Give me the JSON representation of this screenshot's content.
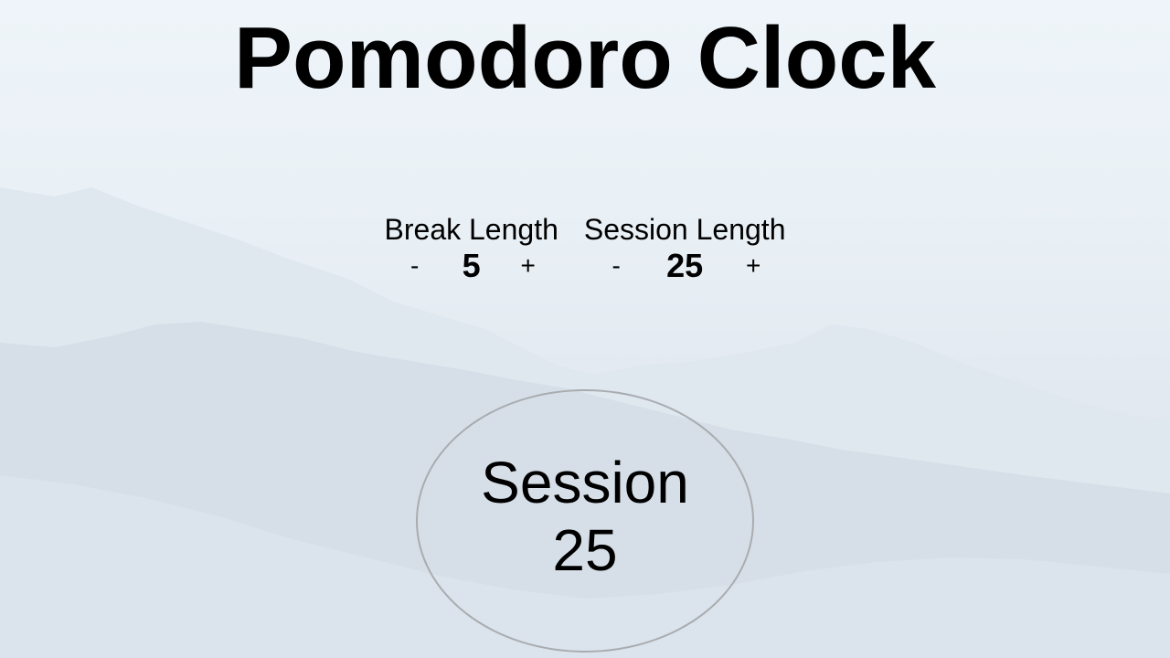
{
  "app": {
    "title": "Pomodoro Clock"
  },
  "break": {
    "label": "Break Length",
    "decrement_label": "-",
    "value": "5",
    "increment_label": "+"
  },
  "session": {
    "label": "Session Length",
    "decrement_label": "-",
    "value": "25",
    "increment_label": "+"
  },
  "timer": {
    "mode_label": "Session",
    "time": "25"
  },
  "colors": {
    "sky": "#eef4f9",
    "mountain_far": "#dfe6ee",
    "mountain_near": "#cfd9e4",
    "timer_border": "#a9acaf"
  }
}
